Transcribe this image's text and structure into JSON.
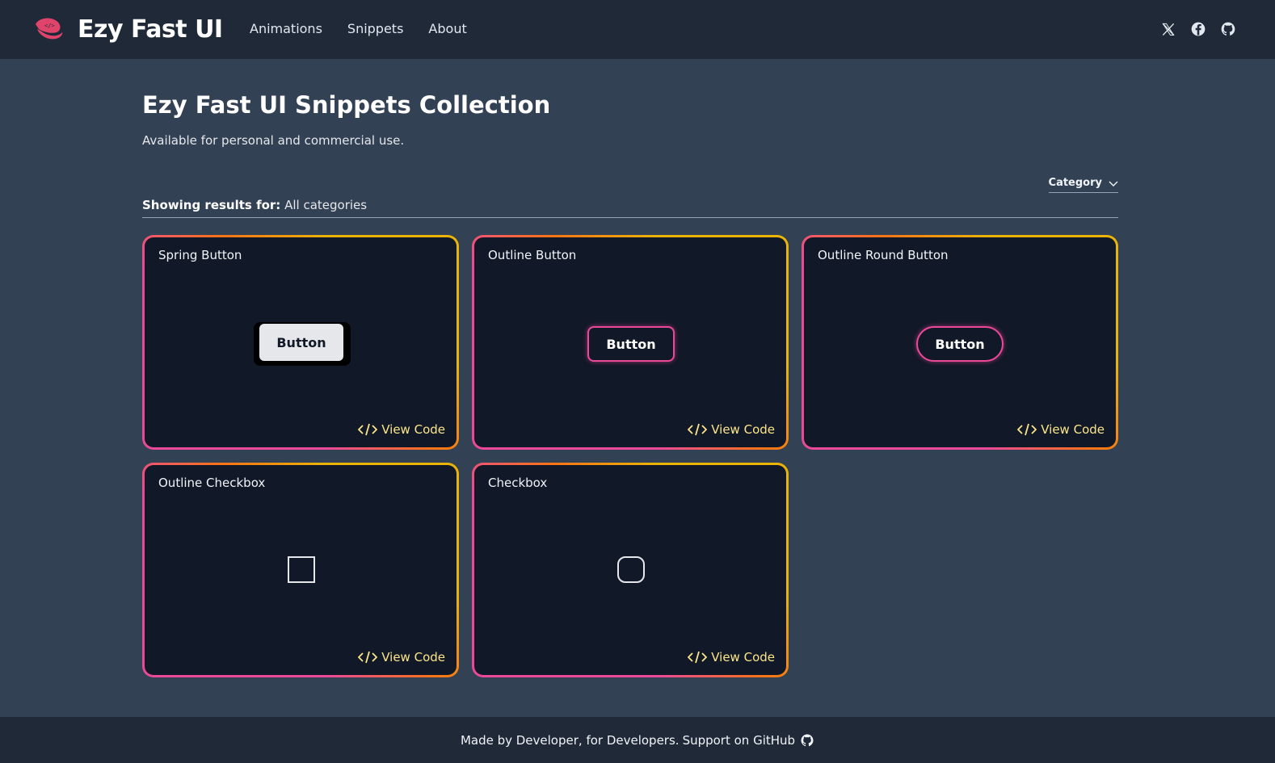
{
  "header": {
    "brand": "Ezy Fast UI",
    "nav": [
      "Animations",
      "Snippets",
      "About"
    ],
    "social_icons": [
      "x-icon",
      "facebook-icon",
      "github-icon"
    ]
  },
  "main": {
    "title": "Ezy Fast UI Snippets Collection",
    "subtitle": "Available for personal and commercial use.",
    "category_label": "Category",
    "results_prefix": "Showing results for:",
    "results_value": "All categories"
  },
  "cards": [
    {
      "title": "Spring Button",
      "preview_label": "Button",
      "view_code": "View Code"
    },
    {
      "title": "Outline Button",
      "preview_label": "Button",
      "view_code": "View Code"
    },
    {
      "title": "Outline Round Button",
      "preview_label": "Button",
      "view_code": "View Code"
    },
    {
      "title": "Outline Checkbox",
      "view_code": "View Code"
    },
    {
      "title": "Checkbox",
      "view_code": "View Code"
    }
  ],
  "footer": {
    "text": "Made by Developer, for Developers.",
    "link": "Support on GitHub"
  },
  "colors": {
    "accent_pink": "#ec4899",
    "accent_yellow": "#eab308",
    "header_bg": "#1f2937",
    "page_bg": "#334155",
    "card_bg": "#111827"
  }
}
